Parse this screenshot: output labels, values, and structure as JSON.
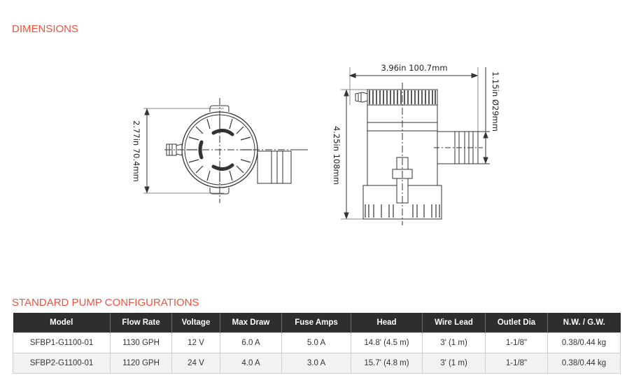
{
  "dimensions": {
    "title": "DIMENSIONS",
    "top_view": {
      "height_label": "2.77in  70.4mm"
    },
    "side_view": {
      "width_label": "3.96in  100.7mm",
      "height_label": "4.25in  108mm",
      "outlet_label": "1.15in  Ø29mm"
    }
  },
  "configurations": {
    "title": "STANDARD PUMP CONFIGURATIONS",
    "columns": [
      "Model",
      "Flow Rate",
      "Voltage",
      "Max Draw",
      "Fuse Amps",
      "Head",
      "Wire Lead",
      "Outlet Dia",
      "N.W. / G.W."
    ],
    "rows": [
      [
        "SFBP1-G1100-01",
        "1130 GPH",
        "12 V",
        "6.0 A",
        "5.0 A",
        "14.8' (4.5 m)",
        "3' (1 m)",
        "1-1/8\"",
        "0.38/0.44 kg"
      ],
      [
        "SFBP2-G1100-01",
        "1120 GPH",
        "24 V",
        "4.0 A",
        "3.0 A",
        "15.7' (4.8 m)",
        "3' (1 m)",
        "1-1/8\"",
        "0.38/0.44 kg"
      ]
    ]
  },
  "colors": {
    "accent": "#e8553e",
    "header_bg": "#2e2e2e",
    "row_alt_bg": "#f2f2f2"
  }
}
